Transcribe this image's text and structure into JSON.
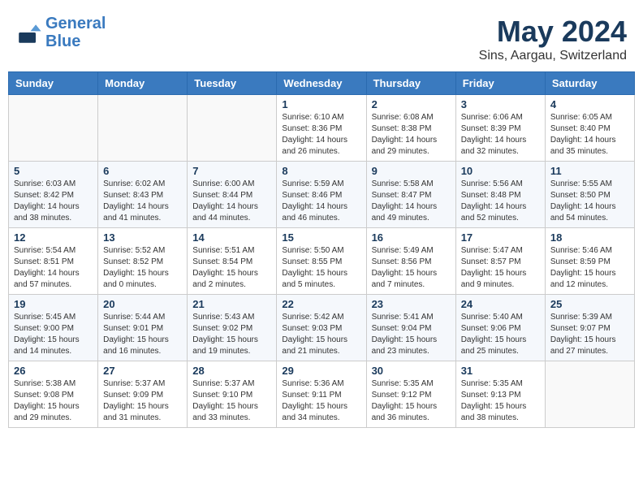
{
  "logo": {
    "line1": "General",
    "line2": "Blue"
  },
  "title": "May 2024",
  "subtitle": "Sins, Aargau, Switzerland",
  "header_row": [
    "Sunday",
    "Monday",
    "Tuesday",
    "Wednesday",
    "Thursday",
    "Friday",
    "Saturday"
  ],
  "weeks": [
    [
      {
        "day": "",
        "info": ""
      },
      {
        "day": "",
        "info": ""
      },
      {
        "day": "",
        "info": ""
      },
      {
        "day": "1",
        "info": "Sunrise: 6:10 AM\nSunset: 8:36 PM\nDaylight: 14 hours\nand 26 minutes."
      },
      {
        "day": "2",
        "info": "Sunrise: 6:08 AM\nSunset: 8:38 PM\nDaylight: 14 hours\nand 29 minutes."
      },
      {
        "day": "3",
        "info": "Sunrise: 6:06 AM\nSunset: 8:39 PM\nDaylight: 14 hours\nand 32 minutes."
      },
      {
        "day": "4",
        "info": "Sunrise: 6:05 AM\nSunset: 8:40 PM\nDaylight: 14 hours\nand 35 minutes."
      }
    ],
    [
      {
        "day": "5",
        "info": "Sunrise: 6:03 AM\nSunset: 8:42 PM\nDaylight: 14 hours\nand 38 minutes."
      },
      {
        "day": "6",
        "info": "Sunrise: 6:02 AM\nSunset: 8:43 PM\nDaylight: 14 hours\nand 41 minutes."
      },
      {
        "day": "7",
        "info": "Sunrise: 6:00 AM\nSunset: 8:44 PM\nDaylight: 14 hours\nand 44 minutes."
      },
      {
        "day": "8",
        "info": "Sunrise: 5:59 AM\nSunset: 8:46 PM\nDaylight: 14 hours\nand 46 minutes."
      },
      {
        "day": "9",
        "info": "Sunrise: 5:58 AM\nSunset: 8:47 PM\nDaylight: 14 hours\nand 49 minutes."
      },
      {
        "day": "10",
        "info": "Sunrise: 5:56 AM\nSunset: 8:48 PM\nDaylight: 14 hours\nand 52 minutes."
      },
      {
        "day": "11",
        "info": "Sunrise: 5:55 AM\nSunset: 8:50 PM\nDaylight: 14 hours\nand 54 minutes."
      }
    ],
    [
      {
        "day": "12",
        "info": "Sunrise: 5:54 AM\nSunset: 8:51 PM\nDaylight: 14 hours\nand 57 minutes."
      },
      {
        "day": "13",
        "info": "Sunrise: 5:52 AM\nSunset: 8:52 PM\nDaylight: 15 hours\nand 0 minutes."
      },
      {
        "day": "14",
        "info": "Sunrise: 5:51 AM\nSunset: 8:54 PM\nDaylight: 15 hours\nand 2 minutes."
      },
      {
        "day": "15",
        "info": "Sunrise: 5:50 AM\nSunset: 8:55 PM\nDaylight: 15 hours\nand 5 minutes."
      },
      {
        "day": "16",
        "info": "Sunrise: 5:49 AM\nSunset: 8:56 PM\nDaylight: 15 hours\nand 7 minutes."
      },
      {
        "day": "17",
        "info": "Sunrise: 5:47 AM\nSunset: 8:57 PM\nDaylight: 15 hours\nand 9 minutes."
      },
      {
        "day": "18",
        "info": "Sunrise: 5:46 AM\nSunset: 8:59 PM\nDaylight: 15 hours\nand 12 minutes."
      }
    ],
    [
      {
        "day": "19",
        "info": "Sunrise: 5:45 AM\nSunset: 9:00 PM\nDaylight: 15 hours\nand 14 minutes."
      },
      {
        "day": "20",
        "info": "Sunrise: 5:44 AM\nSunset: 9:01 PM\nDaylight: 15 hours\nand 16 minutes."
      },
      {
        "day": "21",
        "info": "Sunrise: 5:43 AM\nSunset: 9:02 PM\nDaylight: 15 hours\nand 19 minutes."
      },
      {
        "day": "22",
        "info": "Sunrise: 5:42 AM\nSunset: 9:03 PM\nDaylight: 15 hours\nand 21 minutes."
      },
      {
        "day": "23",
        "info": "Sunrise: 5:41 AM\nSunset: 9:04 PM\nDaylight: 15 hours\nand 23 minutes."
      },
      {
        "day": "24",
        "info": "Sunrise: 5:40 AM\nSunset: 9:06 PM\nDaylight: 15 hours\nand 25 minutes."
      },
      {
        "day": "25",
        "info": "Sunrise: 5:39 AM\nSunset: 9:07 PM\nDaylight: 15 hours\nand 27 minutes."
      }
    ],
    [
      {
        "day": "26",
        "info": "Sunrise: 5:38 AM\nSunset: 9:08 PM\nDaylight: 15 hours\nand 29 minutes."
      },
      {
        "day": "27",
        "info": "Sunrise: 5:37 AM\nSunset: 9:09 PM\nDaylight: 15 hours\nand 31 minutes."
      },
      {
        "day": "28",
        "info": "Sunrise: 5:37 AM\nSunset: 9:10 PM\nDaylight: 15 hours\nand 33 minutes."
      },
      {
        "day": "29",
        "info": "Sunrise: 5:36 AM\nSunset: 9:11 PM\nDaylight: 15 hours\nand 34 minutes."
      },
      {
        "day": "30",
        "info": "Sunrise: 5:35 AM\nSunset: 9:12 PM\nDaylight: 15 hours\nand 36 minutes."
      },
      {
        "day": "31",
        "info": "Sunrise: 5:35 AM\nSunset: 9:13 PM\nDaylight: 15 hours\nand 38 minutes."
      },
      {
        "day": "",
        "info": ""
      }
    ]
  ]
}
